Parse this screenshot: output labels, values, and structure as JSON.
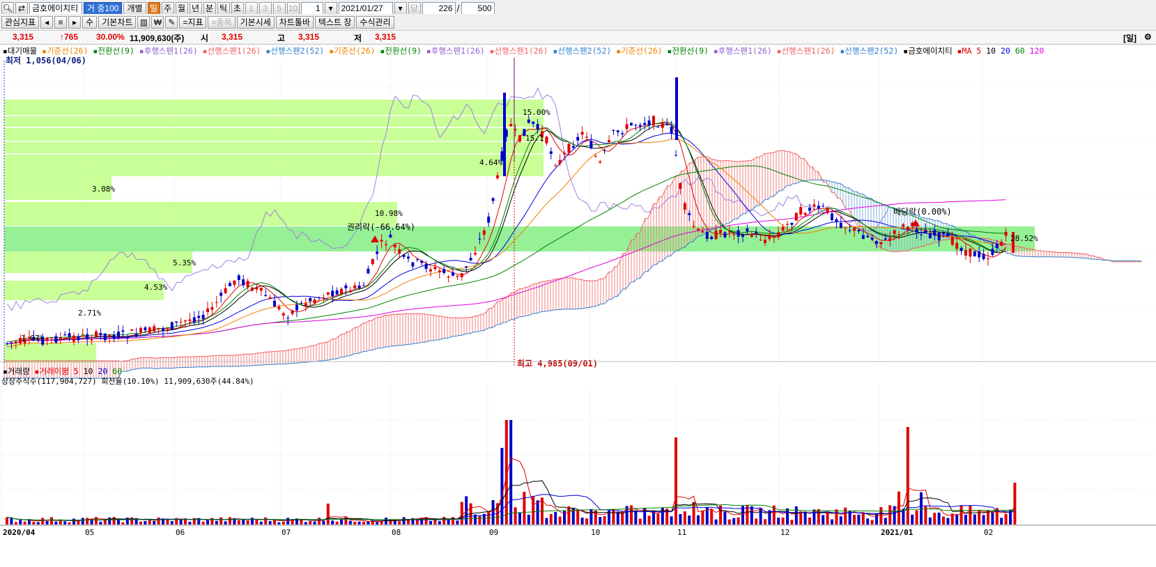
{
  "toolbar": {
    "stock_name": "금호에이치티",
    "vol_button": "거 중100",
    "btn_individual": "개별",
    "periods": [
      "일",
      "주",
      "월",
      "년",
      "분",
      "틱",
      "초"
    ],
    "num_buttons": [
      "1",
      "3",
      "5",
      "10"
    ],
    "num_value": "1",
    "date_value": "2021/01/27",
    "dang_label": "당",
    "count_value": "226",
    "slash": "/",
    "total_value": "500",
    "row2_items": [
      "관심지표",
      "수",
      "기본차트",
      "=지표",
      "=종목",
      "기본시세",
      "차트툴바",
      "텍스트 창",
      "수식관리"
    ]
  },
  "quote": {
    "price": "3,315",
    "change": "↑765",
    "pct": "30.00%",
    "volume": "11,909,630(주)",
    "open_label": "시",
    "open": "3,315",
    "high_label": "고",
    "high": "3,315",
    "low_label": "저",
    "low": "3,315",
    "period_tag": "[일]"
  },
  "legend_top": [
    {
      "text": "대기매물",
      "color": "#000000"
    },
    {
      "text": "기준선(26)",
      "color": "#f08000"
    },
    {
      "text": "전환선(9)",
      "color": "#008000"
    },
    {
      "text": "후행스팬1(26)",
      "color": "#9060d0"
    },
    {
      "text": "선행스팬1(26)",
      "color": "#f06060"
    },
    {
      "text": "선행스팬2(52)",
      "color": "#3080d0"
    },
    {
      "text": "기준선(26)",
      "color": "#f08000"
    },
    {
      "text": "전환선(9)",
      "color": "#008000"
    },
    {
      "text": "후행스팬1(26)",
      "color": "#9060d0"
    },
    {
      "text": "선행스팬1(26)",
      "color": "#f06060"
    },
    {
      "text": "선행스팬2(52)",
      "color": "#3080d0"
    },
    {
      "text": "기준선(26)",
      "color": "#f08000"
    },
    {
      "text": "전환선(9)",
      "color": "#008000"
    },
    {
      "text": "후행스팬1(26)",
      "color": "#9060d0"
    },
    {
      "text": "선행스팬1(26)",
      "color": "#f06060"
    },
    {
      "text": "선행스팬2(52)",
      "color": "#3080d0"
    },
    {
      "text": "금호에이치티",
      "color": "#000000"
    },
    {
      "text": "MA",
      "color": "#e00000"
    },
    {
      "text": "5",
      "color": "#e00000"
    },
    {
      "text": "10",
      "color": "#000000"
    },
    {
      "text": "20",
      "color": "#0000e0"
    },
    {
      "text": "60",
      "color": "#008000"
    },
    {
      "text": "120",
      "color": "#e000e0"
    }
  ],
  "volume_legend": [
    {
      "text": "거래량",
      "color": "#000000"
    },
    {
      "text": "거래이평",
      "color": "#e00000"
    },
    {
      "text": "5",
      "color": "#e00000"
    },
    {
      "text": "10",
      "color": "#000000"
    },
    {
      "text": "20",
      "color": "#0000e0"
    },
    {
      "text": "60",
      "color": "#008000"
    }
  ],
  "volume_info": "상장주식수(117,904,727) 회전율(10.10%) 11,909,630주(44.84%)",
  "chart_data": {
    "type": "candlestick",
    "x_ticks": [
      "2020/04",
      "05",
      "06",
      "07",
      "08",
      "09",
      "10",
      "11",
      "12",
      "2021/01",
      "02"
    ],
    "annotations": {
      "low": "최저 1,056(04/06)",
      "high": "최고 4,985(09/01)",
      "rights": "권리락(-66.64%)",
      "dividend": "배당락(0.00%)"
    },
    "price_zone_labels": [
      "1.07%",
      "2.71%",
      "4.53%",
      "5.35%",
      "3.08%",
      "10.98%",
      "15.00%",
      "15.1",
      "4.64%",
      "28.52%"
    ],
    "colors": {
      "up": "#e00000",
      "down": "#0000c8",
      "zone_light": "#c8ff96",
      "zone_main": "#96f096"
    }
  }
}
